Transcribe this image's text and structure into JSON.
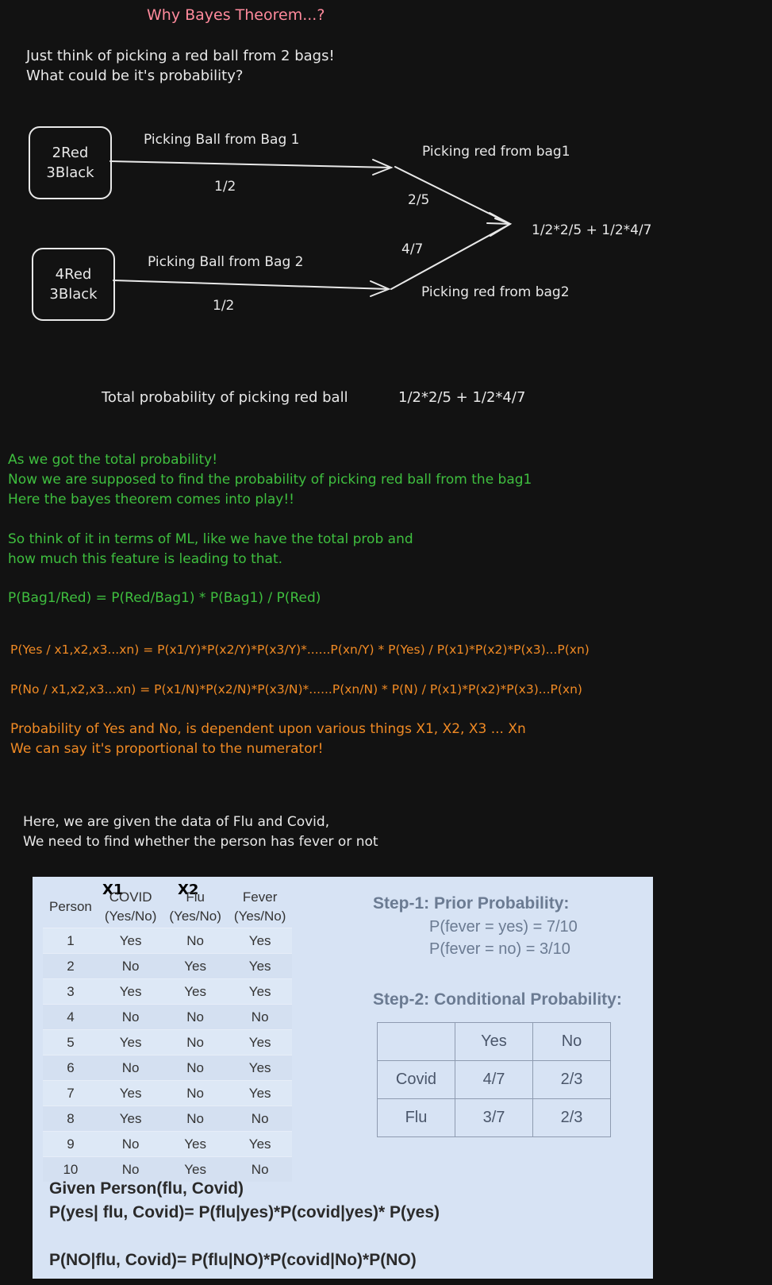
{
  "title": "Why Bayes Theorem...?",
  "intro": [
    "Just think of picking a red ball from 2 bags!",
    "What could be it's probability?"
  ],
  "bag1": {
    "line1": "2Red",
    "line2": "3Black"
  },
  "bag2": {
    "line1": "4Red",
    "line2": "3Black"
  },
  "diagram": {
    "pick_bag1": "Picking Ball from Bag 1",
    "pick_bag2": "Picking Ball from Bag 2",
    "half1": "1/2",
    "half2": "1/2",
    "red_bag1": "Picking red from bag1",
    "red_bag2": "Picking red from bag2",
    "p_red_bag1": "2/5",
    "p_red_bag2": "4/7",
    "result": "1/2*2/5 + 1/2*4/7"
  },
  "total_label": "Total probability of picking red ball",
  "total_value": "1/2*2/5 + 1/2*4/7",
  "green_text": [
    "As we got the total probability!",
    "Now we are supposed to find the probability of picking red ball from the bag1",
    "Here the bayes theorem comes into play!!",
    "So think of it in terms of ML, like we have the total prob and",
    "how much this feature is leading to that.",
    "P(Bag1/Red) = P(Red/Bag1) * P(Bag1) / P(Red)"
  ],
  "orange_text": [
    "P(Yes / x1,x2,x3...xn) = P(x1/Y)*P(x2/Y)*P(x3/Y)*......P(xn/Y) * P(Yes) / P(x1)*P(x2)*P(x3)...P(xn)",
    "P(No / x1,x2,x3...xn) = P(x1/N)*P(x2/N)*P(x3/N)*......P(xn/N) * P(N) / P(x1)*P(x2)*P(x3)...P(xn)",
    "Probability of Yes and No, is dependent upon various things X1, X2, X3 ... Xn",
    "We can say it's proportional to the numerator!"
  ],
  "given_text": [
    "Here, we are given the data of Flu and Covid,",
    "We need to find whether the person has fever or not"
  ],
  "table": {
    "x1": "X1",
    "x2": "X2",
    "headers": [
      [
        "Person",
        ""
      ],
      [
        "COVID",
        "(Yes/No)"
      ],
      [
        "Flu",
        "(Yes/No)"
      ],
      [
        "Fever",
        "(Yes/No)"
      ]
    ],
    "rows": [
      [
        "1",
        "Yes",
        "No",
        "Yes"
      ],
      [
        "2",
        "No",
        "Yes",
        "Yes"
      ],
      [
        "3",
        "Yes",
        "Yes",
        "Yes"
      ],
      [
        "4",
        "No",
        "No",
        "No"
      ],
      [
        "5",
        "Yes",
        "No",
        "Yes"
      ],
      [
        "6",
        "No",
        "No",
        "Yes"
      ],
      [
        "7",
        "Yes",
        "No",
        "Yes"
      ],
      [
        "8",
        "Yes",
        "No",
        "No"
      ],
      [
        "9",
        "No",
        "Yes",
        "Yes"
      ],
      [
        "10",
        "No",
        "Yes",
        "No"
      ]
    ]
  },
  "step1": {
    "title": "Step-1: Prior Probability:",
    "yes": "P(fever = yes) = 7/10",
    "no": "P(fever = no) = 3/10"
  },
  "step2": {
    "title": "Step-2: Conditional Probability:",
    "grid": [
      [
        "",
        "Yes",
        "No"
      ],
      [
        "Covid",
        "4/7",
        "2/3"
      ],
      [
        "Flu",
        "3/7",
        "2/3"
      ]
    ]
  },
  "formulas": {
    "given": "Given Person(flu, Covid)",
    "p_yes": "P(yes| flu, Covid)= P(flu|yes)*P(covid|yes)* P(yes)",
    "p_no": "P(NO|flu, Covid)= P(flu|NO)*P(covid|No)*P(NO)"
  },
  "colors": {
    "title": "#ff8a9c",
    "green": "#3fbf3f",
    "orange": "#f08a24",
    "panel": "#d7e3f4"
  }
}
